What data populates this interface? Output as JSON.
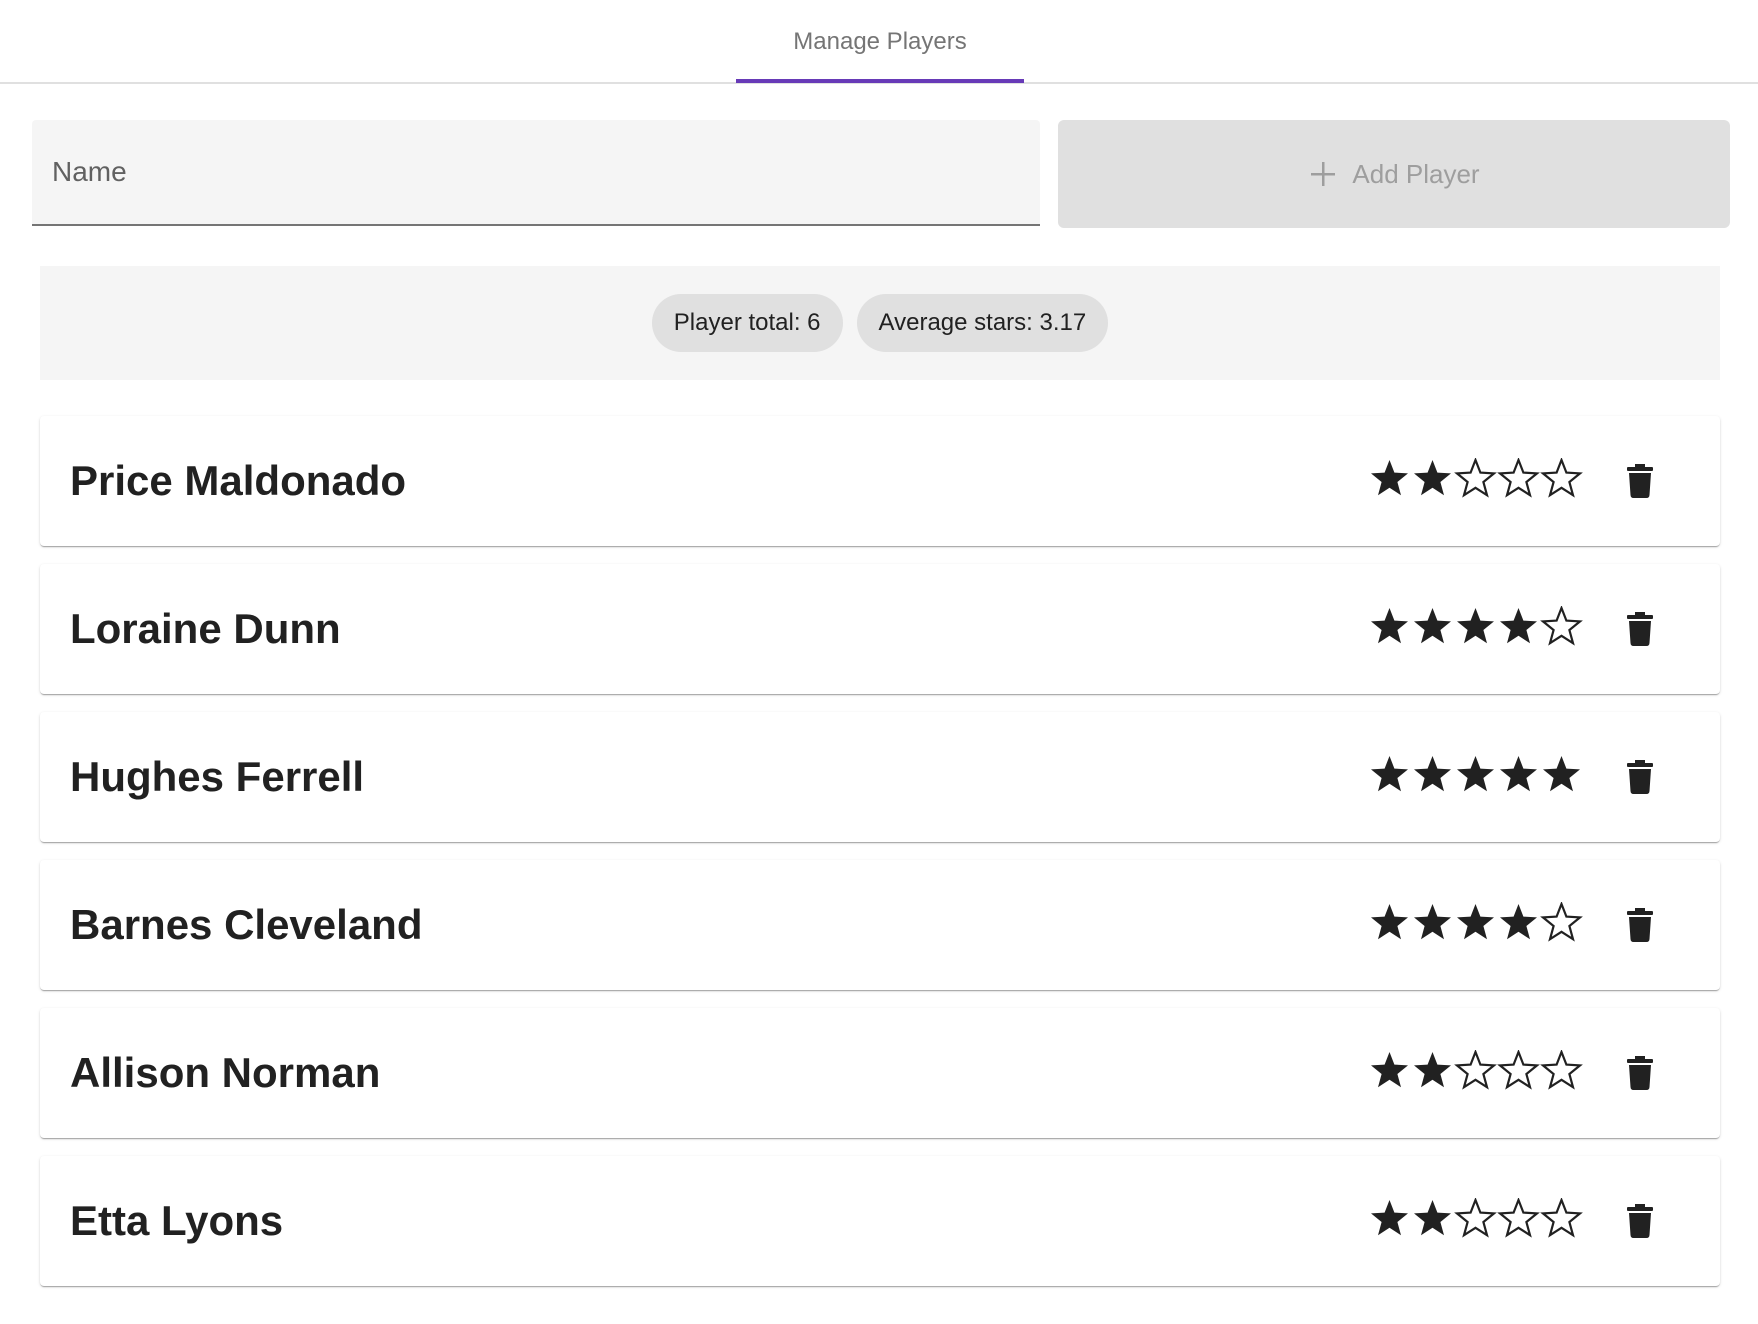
{
  "tabs": [
    {
      "label": "Manage Players",
      "active": true
    }
  ],
  "form": {
    "name_placeholder": "Name",
    "name_value": "",
    "add_button_label": "Add Player",
    "add_button_icon": "plus-icon"
  },
  "stats": {
    "player_total": "Player total: 6",
    "average_stars": "Average stars: 3.17"
  },
  "players": [
    {
      "name": "Price Maldonado",
      "stars": 2,
      "max_stars": 5
    },
    {
      "name": "Loraine Dunn",
      "stars": 4,
      "max_stars": 5
    },
    {
      "name": "Hughes Ferrell",
      "stars": 5,
      "max_stars": 5
    },
    {
      "name": "Barnes Cleveland",
      "stars": 4,
      "max_stars": 5
    },
    {
      "name": "Allison Norman",
      "stars": 2,
      "max_stars": 5
    },
    {
      "name": "Etta Lyons",
      "stars": 2,
      "max_stars": 5
    }
  ],
  "icons": {
    "star_filled": "star-filled-icon",
    "star_empty": "star-outline-icon",
    "delete": "trash-icon"
  },
  "colors": {
    "accent": "#673ab7",
    "star": "#212121",
    "text": "#212121",
    "chip_bg": "#e0e0e0",
    "panel_bg": "#f5f5f5",
    "disabled_text": "#9e9e9e"
  }
}
